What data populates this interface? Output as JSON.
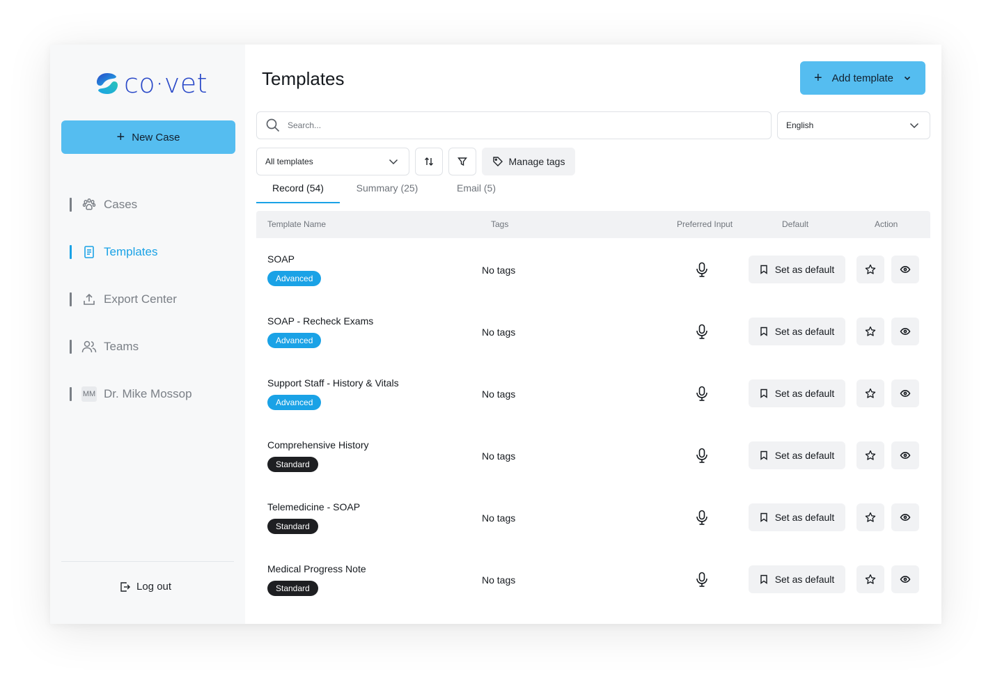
{
  "brand": {
    "name": "co·vet"
  },
  "sidebar": {
    "new_case_label": "New Case",
    "items": [
      {
        "label": "Cases",
        "icon": "paw-icon",
        "active": false
      },
      {
        "label": "Templates",
        "icon": "document-icon",
        "active": true
      },
      {
        "label": "Export Center",
        "icon": "upload-icon",
        "active": false
      },
      {
        "label": "Teams",
        "icon": "users-icon",
        "active": false
      },
      {
        "label": "Dr. Mike Mossop",
        "icon": "avatar-initials",
        "initials": "MM",
        "active": false
      }
    ],
    "logout_label": "Log out"
  },
  "header": {
    "title": "Templates",
    "add_template_label": "Add template"
  },
  "search": {
    "placeholder": "Search..."
  },
  "language": {
    "selected": "English"
  },
  "filter": {
    "selected": "All templates"
  },
  "manage_tags_label": "Manage tags",
  "tabs": [
    {
      "label": "Record (54)",
      "active": true
    },
    {
      "label": "Summary (25)",
      "active": false
    },
    {
      "label": "Email (5)",
      "active": false
    }
  ],
  "table": {
    "columns": [
      "Template Name",
      "Tags",
      "Preferred Input",
      "Default",
      "Action"
    ],
    "set_default_label": "Set as default",
    "rows": [
      {
        "name": "SOAP",
        "badge": "Advanced",
        "tags": "No tags",
        "input": "microphone-icon"
      },
      {
        "name": "SOAP - Recheck Exams",
        "badge": "Advanced",
        "tags": "No tags",
        "input": "microphone-icon"
      },
      {
        "name": "Support Staff - History & Vitals",
        "badge": "Advanced",
        "tags": "No tags",
        "input": "microphone-icon"
      },
      {
        "name": "Comprehensive History",
        "badge": "Standard",
        "tags": "No tags",
        "input": "microphone-icon"
      },
      {
        "name": "Telemedicine - SOAP",
        "badge": "Standard",
        "tags": "No tags",
        "input": "microphone-icon"
      },
      {
        "name": "Medical Progress Note",
        "badge": "Standard",
        "tags": "No tags",
        "input": "microphone-icon"
      }
    ]
  },
  "colors": {
    "accent": "#1aa2e6",
    "button": "#55bdf0",
    "badge_advanced": "#1aa2e6",
    "badge_standard": "#1e1f22"
  }
}
